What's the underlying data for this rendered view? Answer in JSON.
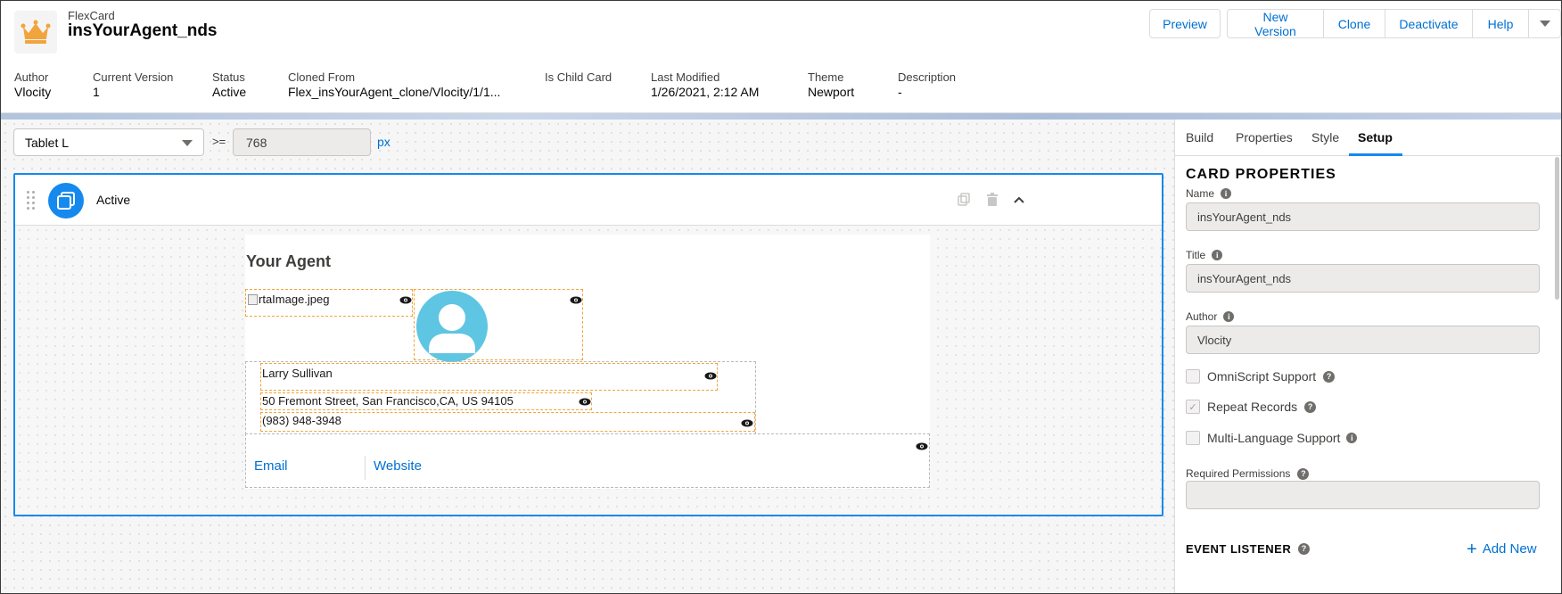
{
  "header": {
    "object_type": "FlexCard",
    "card_name": "insYourAgent_nds",
    "buttons": {
      "preview": "Preview",
      "new_version": "New Version",
      "clone": "Clone",
      "deactivate": "Deactivate",
      "help": "Help"
    }
  },
  "highlights": [
    {
      "label": "Author",
      "value": "Vlocity"
    },
    {
      "label": "Current Version",
      "value": "1"
    },
    {
      "label": "Status",
      "value": "Active"
    },
    {
      "label": "Cloned From",
      "value": "Flex_insYourAgent_clone/Vlocity/1/1..."
    },
    {
      "label": "Is Child Card",
      "value": ""
    },
    {
      "label": "Last Modified",
      "value": "1/26/2021, 2:12 AM"
    },
    {
      "label": "Theme",
      "value": "Newport"
    },
    {
      "label": "Description",
      "value": "-"
    }
  ],
  "canvas": {
    "device": "Tablet L",
    "operator": ">=",
    "width_value": "768",
    "unit": "px",
    "state": {
      "name": "Active",
      "card": {
        "title": "Your Agent",
        "image_alt": "rtaImage.jpeg",
        "agent_name": "Larry Sullivan",
        "address": "50 Fremont Street, San Francisco,CA, US 94105",
        "phone": "(983) 948-3948",
        "email_link": "Email",
        "website_link": "Website"
      }
    }
  },
  "panel": {
    "tabs": [
      "Build",
      "Properties",
      "Style",
      "Setup"
    ],
    "active_tab": "Setup",
    "card_properties": {
      "heading": "CARD PROPERTIES",
      "name_label": "Name",
      "name_value": "insYourAgent_nds",
      "title_label": "Title",
      "title_value": "insYourAgent_nds",
      "author_label": "Author",
      "author_value": "Vlocity",
      "omniscript_support": "OmniScript Support",
      "repeat_records": "Repeat Records",
      "multi_language": "Multi-Language Support",
      "required_permissions": "Required Permissions",
      "required_permissions_value": ""
    },
    "event_listener": {
      "heading": "EVENT LISTENER",
      "add_new": "Add New"
    }
  },
  "colors": {
    "brand_blue": "#0070d2",
    "selection_blue": "#1589ee",
    "avatar_cyan": "#5ec5e3",
    "logo_orange": "#f2a43c"
  }
}
